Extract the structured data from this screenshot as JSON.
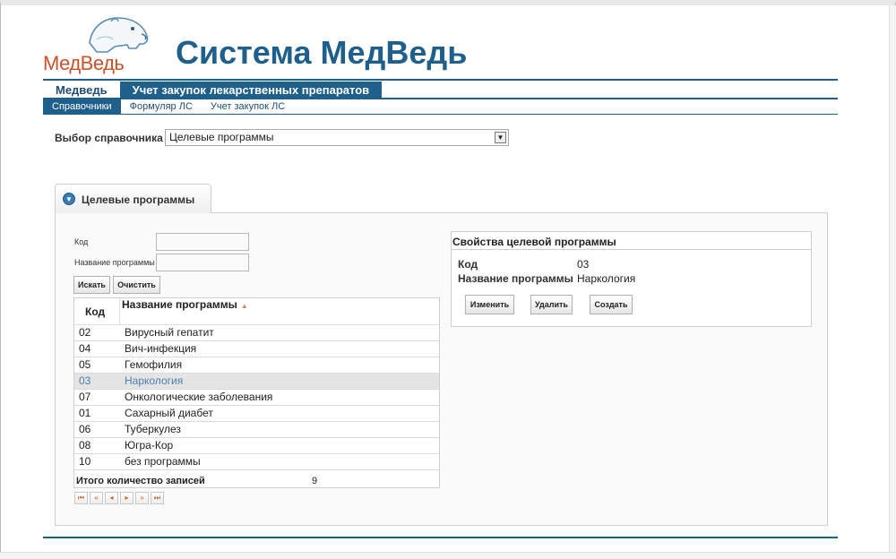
{
  "app": {
    "logo_text": "МедВедь",
    "title": "Система МедВедь"
  },
  "nav": {
    "main": [
      {
        "label": "Медведь",
        "active": false
      },
      {
        "label": "Учет закупок лекарственных препаратов",
        "active": true
      }
    ],
    "sub": [
      {
        "label": "Справочники",
        "active": true
      },
      {
        "label": "Формуляр ЛС",
        "active": false
      },
      {
        "label": "Учет закупок ЛС",
        "active": false
      }
    ]
  },
  "selector": {
    "label": "Выбор справочника",
    "value": "Целевые программы"
  },
  "panel": {
    "tab_title": "Целевые программы"
  },
  "search": {
    "code_label": "Код",
    "code_value": "",
    "name_label": "Название программы",
    "name_value": "",
    "search_button": "Искать",
    "clear_button": "Очистить"
  },
  "table": {
    "columns": [
      "Код",
      "Название программы"
    ],
    "rows": [
      {
        "code": "02",
        "name": "Вирусный гепатит"
      },
      {
        "code": "04",
        "name": "Вич-инфекция"
      },
      {
        "code": "05",
        "name": "Гемофилия"
      },
      {
        "code": "03",
        "name": "Наркология"
      },
      {
        "code": "07",
        "name": "Онкологические заболевания"
      },
      {
        "code": "01",
        "name": "Сахарный диабет"
      },
      {
        "code": "06",
        "name": "Туберкулез"
      },
      {
        "code": "08",
        "name": "Югра-Кор"
      },
      {
        "code": "10",
        "name": "без программы"
      }
    ],
    "selected_code": "03",
    "total_label": "Итого количество записей",
    "total_value": "9"
  },
  "properties": {
    "title": "Свойства целевой программы",
    "code_label": "Код",
    "code_value": "03",
    "name_label": "Название программы",
    "name_value": "Наркология",
    "edit_button": "Изменить",
    "delete_button": "Удалить",
    "create_button": "Создать"
  },
  "colors": {
    "brand": "#1f5f8c",
    "logo_accent": "#c8532a",
    "selected_text": "#4a7fb0"
  }
}
